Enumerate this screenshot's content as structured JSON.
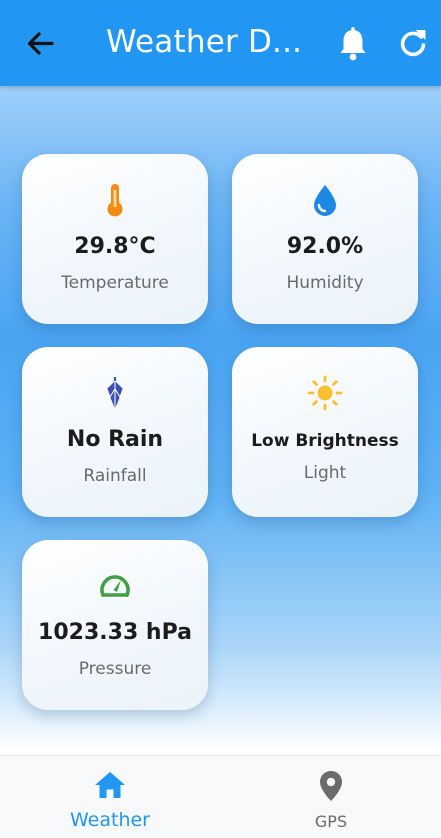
{
  "appbar": {
    "title": "Weather D...",
    "color": "#2196f3",
    "icons": [
      "arrow-back-icon",
      "bell-icon",
      "refresh-icon"
    ]
  },
  "cards": [
    {
      "icon": "thermometer-icon",
      "value": "29.8°C",
      "label": "Temperature",
      "icon_color": "#f28c10"
    },
    {
      "icon": "water-drop-icon",
      "value": "92.0%",
      "label": "Humidity",
      "icon_color": "#1e88e5"
    },
    {
      "icon": "umbrella-icon",
      "value": "No Rain",
      "label": "Rainfall",
      "icon_color": "#3f51b5"
    },
    {
      "icon": "sun-icon",
      "value": "Low Brightness",
      "label": "Light",
      "icon_color": "#fbc02d"
    },
    {
      "icon": "speedometer-icon",
      "value": "1023.33 hPa",
      "label": "Pressure",
      "icon_color": "#43a047"
    }
  ],
  "bottom_nav": {
    "items": [
      {
        "icon": "home-icon",
        "label": "Weather",
        "active": true
      },
      {
        "icon": "location-pin-icon",
        "label": "GPS",
        "active": false
      }
    ],
    "active_color": "#2196f3"
  }
}
